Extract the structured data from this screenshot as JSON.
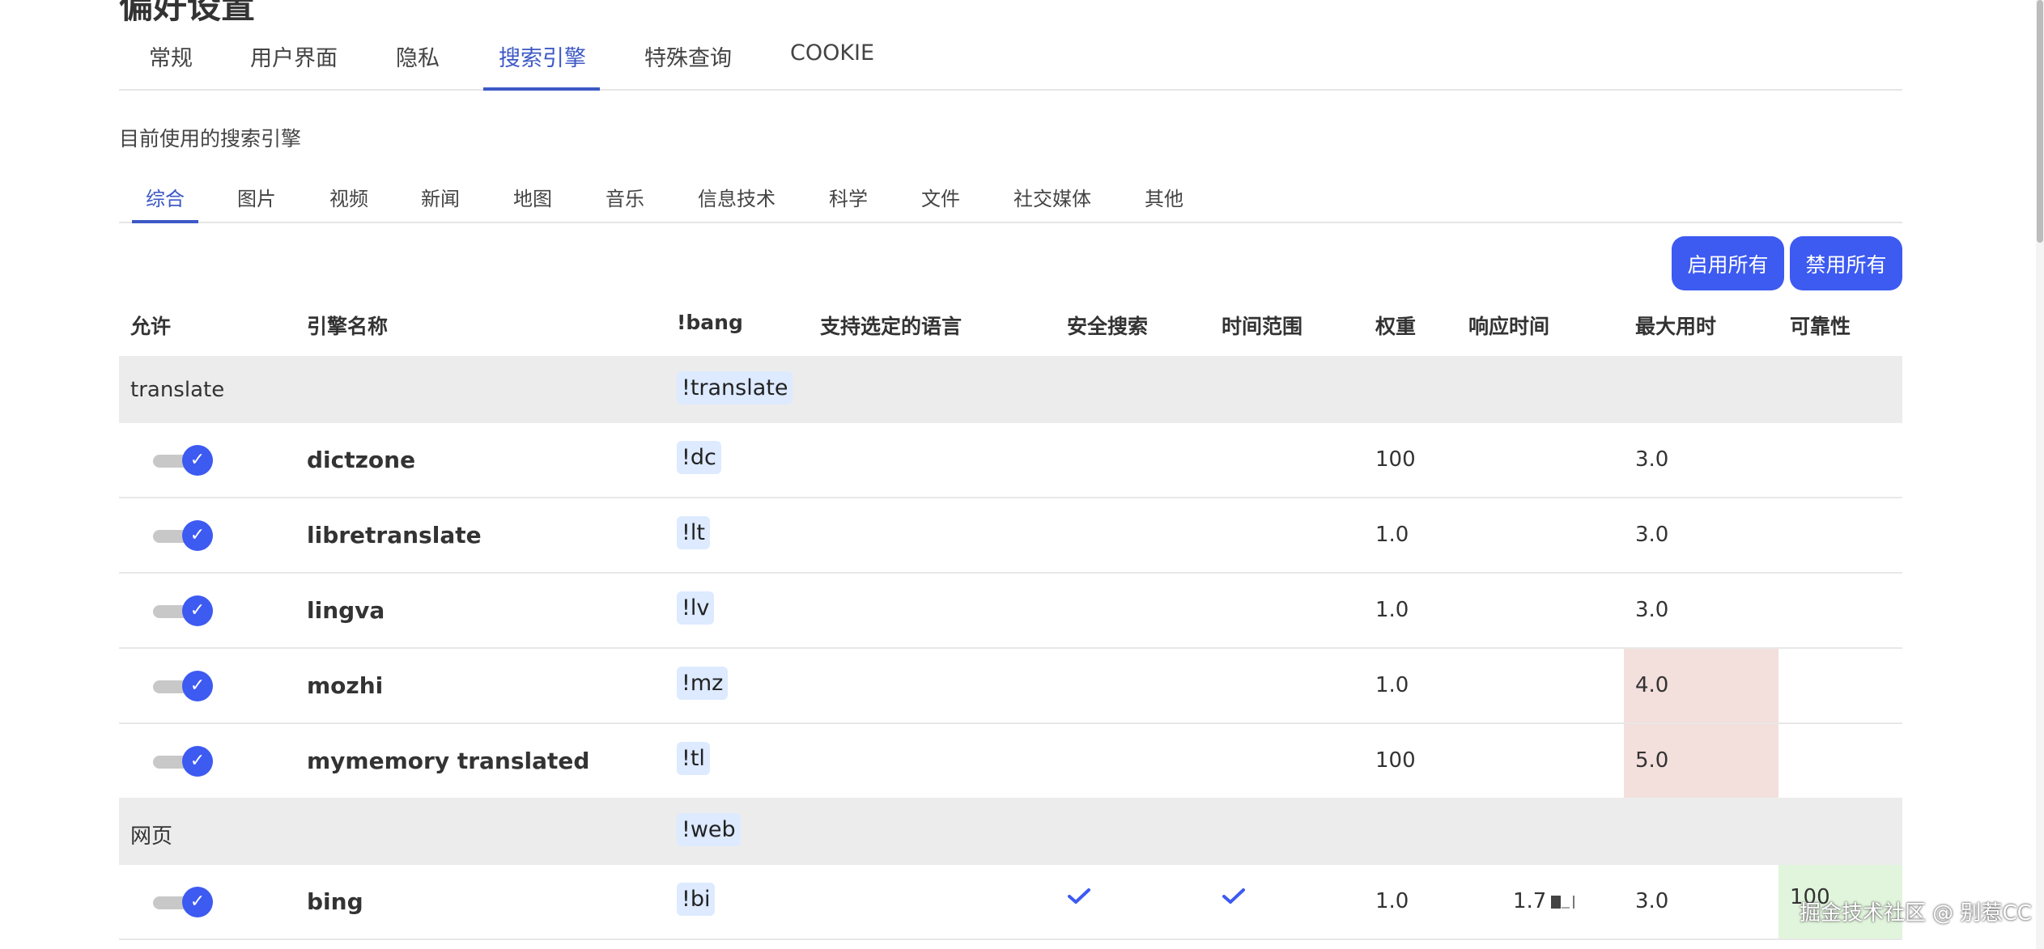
{
  "page": {
    "heading_fragment": "偏好设置"
  },
  "main_tabs": [
    {
      "label": "常规"
    },
    {
      "label": "用户界面"
    },
    {
      "label": "隐私"
    },
    {
      "label": "搜索引擎"
    },
    {
      "label": "特殊查询"
    },
    {
      "label": "COOKIE"
    }
  ],
  "main_tabs_active": "搜索引擎",
  "section_label": "目前使用的搜索引擎",
  "sub_tabs": [
    {
      "label": "综合"
    },
    {
      "label": "图片"
    },
    {
      "label": "视频"
    },
    {
      "label": "新闻"
    },
    {
      "label": "地图"
    },
    {
      "label": "音乐"
    },
    {
      "label": "信息技术"
    },
    {
      "label": "科学"
    },
    {
      "label": "文件"
    },
    {
      "label": "社交媒体"
    },
    {
      "label": "其他"
    }
  ],
  "sub_tabs_active": "综合",
  "buttons": {
    "enable_all": "启用所有",
    "disable_all": "禁用所有"
  },
  "table": {
    "headers": {
      "allow": "允许",
      "name": "引擎名称",
      "bang": "!bang",
      "lang": "支持选定的语言",
      "safe": "安全搜索",
      "time_range": "时间范围",
      "weight": "权重",
      "response": "响应时间",
      "max_time": "最大用时",
      "reliability": "可靠性"
    },
    "groups": [
      {
        "name": "translate",
        "bang": "!translate",
        "engines": [
          {
            "name": "dictzone",
            "bang": "!dc",
            "weight": "100",
            "max_time": "3.0",
            "enabled": true,
            "safe": false,
            "time_range": false,
            "response": "",
            "reliability": ""
          },
          {
            "name": "libretranslate",
            "bang": "!lt",
            "weight": "1.0",
            "max_time": "3.0",
            "enabled": true,
            "safe": false,
            "time_range": false,
            "response": "",
            "reliability": ""
          },
          {
            "name": "lingva",
            "bang": "!lv",
            "weight": "1.0",
            "max_time": "3.0",
            "enabled": true,
            "safe": false,
            "time_range": false,
            "response": "",
            "reliability": ""
          },
          {
            "name": "mozhi",
            "bang": "!mz",
            "weight": "1.0",
            "max_time": "4.0",
            "enabled": true,
            "safe": false,
            "time_range": false,
            "response": "",
            "reliability": "",
            "max_time_warn": true
          },
          {
            "name": "mymemory translated",
            "bang": "!tl",
            "weight": "100",
            "max_time": "5.0",
            "enabled": true,
            "safe": false,
            "time_range": false,
            "response": "",
            "reliability": "",
            "max_time_warn": true
          }
        ]
      },
      {
        "name": "网页",
        "bang": "!web",
        "engines": [
          {
            "name": "bing",
            "bang": "!bi",
            "weight": "1.0",
            "max_time": "3.0",
            "enabled": true,
            "safe": true,
            "time_range": true,
            "response": "1.7",
            "reliability": "100"
          }
        ]
      }
    ]
  },
  "icons": {
    "toggle_check": "check-mark",
    "safe_search": "check-icon",
    "time_range": "check-icon",
    "response_bar": "bar-chart-icon"
  },
  "colors": {
    "accent": "#3d5af1",
    "tab_active": "#3d59c6",
    "bang_bg": "#ddeaff",
    "group_bg": "#ececec",
    "warn_bg": "#f3dfdc",
    "good_bg": "#e1f5dc"
  },
  "watermark": "掘金技术社区 @ 别惹CC"
}
